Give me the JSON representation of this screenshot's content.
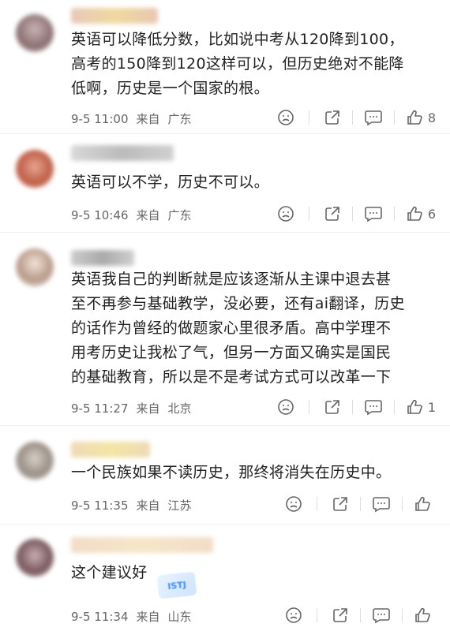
{
  "comments": [
    {
      "lines": [
        "英语可以降低分数，比如说中考从120降到100，",
        "高考的150降到120这样可以，但历史绝对不能降",
        "低啊，历史是一个国家的根。"
      ],
      "date": "9-5 11:00",
      "from": "来自",
      "location": "广东",
      "likes": "8"
    },
    {
      "lines": [
        "英语可以不学，历史不可以。"
      ],
      "date": "9-5 10:46",
      "from": "来自",
      "location": "广东",
      "likes": "6"
    },
    {
      "lines": [
        "英语我自己的判断就是应该逐渐从主课中退去甚",
        "至不再参与基础教学，没必要，还有ai翻译，历史",
        "的话作为曾经的做题家心里很矛盾。高中学理不",
        "用考历史让我松了气，但另一方面又确实是国民",
        "的基础教育，所以是不是考试方式可以改革一下"
      ],
      "date": "9-5 11:27",
      "from": "来自",
      "location": "北京",
      "likes": "1"
    },
    {
      "lines": [
        "一个民族如果不读历史，那终将消失在历史中。"
      ],
      "date": "9-5 11:35",
      "from": "来自",
      "location": "江苏",
      "likes": ""
    },
    {
      "lines": [
        "这个建议好"
      ],
      "date": "9-5 11:34",
      "from": "来自",
      "location": "山东",
      "likes": ""
    }
  ],
  "badge_text": "ISTJ",
  "icons": [
    "dislike-icon",
    "share-icon",
    "comment-icon",
    "like-icon"
  ],
  "colors": {
    "text": "#222222",
    "meta": "#666666",
    "divider": "#efefef"
  }
}
